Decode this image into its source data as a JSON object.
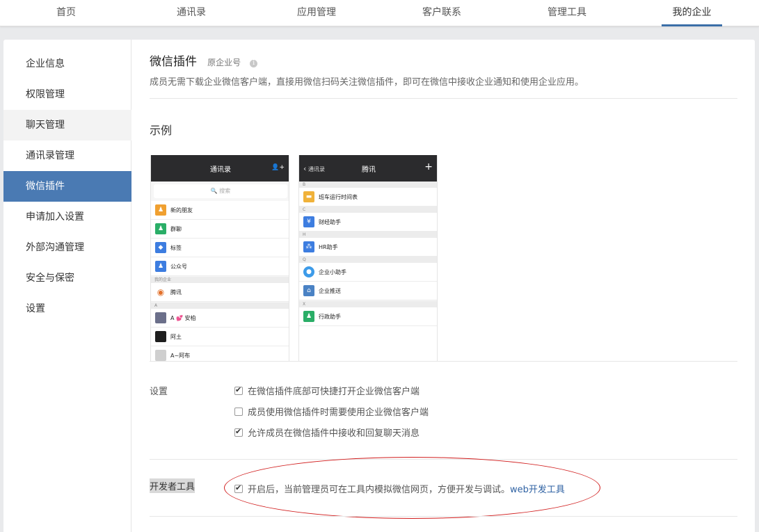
{
  "topnav": {
    "tabs": [
      {
        "label": "首页"
      },
      {
        "label": "通讯录"
      },
      {
        "label": "应用管理"
      },
      {
        "label": "客户联系"
      },
      {
        "label": "管理工具"
      },
      {
        "label": "我的企业"
      }
    ],
    "active_tab": "我的企业"
  },
  "sidebar": {
    "items": [
      {
        "label": "企业信息"
      },
      {
        "label": "权限管理"
      },
      {
        "label": "聊天管理"
      },
      {
        "label": "通讯录管理"
      },
      {
        "label": "微信插件"
      },
      {
        "label": "申请加入设置"
      },
      {
        "label": "外部沟通管理"
      },
      {
        "label": "安全与保密"
      },
      {
        "label": "设置"
      }
    ],
    "active_item": "微信插件",
    "hovered_item": "聊天管理"
  },
  "main": {
    "title": "微信插件",
    "subtitle": "原企业号",
    "info_icon": "i",
    "description": "成员无需下载企业微信客户端，直接用微信扫码关注微信插件，即可在微信中接收企业通知和使用企业应用。",
    "example_label": "示例",
    "phone1": {
      "title": "通讯录",
      "add_icon": "👤+",
      "search_placeholder": "🔍 搜索",
      "rows": [
        {
          "label": "新的朋友",
          "icon": "person-add-icon",
          "color": "#f0a030"
        },
        {
          "label": "群聊",
          "icon": "group-icon",
          "color": "#2aae67"
        },
        {
          "label": "标签",
          "icon": "tag-icon",
          "color": "#3d7de0"
        },
        {
          "label": "公众号",
          "icon": "official-account-icon",
          "color": "#3d7de0"
        }
      ],
      "section_company": "我的企业",
      "company_row": {
        "label": "腾讯",
        "icon": "tencent-logo"
      },
      "section_a": "A",
      "contacts": [
        {
          "label": "A 💕 安柏"
        },
        {
          "label": "阿土"
        },
        {
          "label": "A~阿布"
        }
      ]
    },
    "phone2": {
      "back_label": "通讯录",
      "title": "腾讯",
      "plus": "+",
      "sections": [
        "B",
        "C",
        "H",
        "Q",
        "X"
      ],
      "rows": [
        {
          "label": "班车运行时间表",
          "icon": "bus-schedule-icon",
          "color": "#f0b23a"
        },
        {
          "label": "财经助手",
          "icon": "yen-icon",
          "color": "#3d7de0"
        },
        {
          "label": "HR助手",
          "icon": "hr-icon",
          "color": "#3d7de0"
        },
        {
          "label": "企业小助手",
          "icon": "chat-bubble-icon",
          "color": "#3d9be9"
        },
        {
          "label": "企业推送",
          "icon": "home-icon",
          "color": "#4a82c4"
        },
        {
          "label": "行政助手",
          "icon": "person-icon",
          "color": "#2aae67"
        }
      ]
    },
    "settings": {
      "label": "设置",
      "options": [
        {
          "label": "在微信插件底部可快捷打开企业微信客户端",
          "checked": true
        },
        {
          "label": "成员使用微信插件时需要使用企业微信客户端",
          "checked": false
        },
        {
          "label": "允许成员在微信插件中接收和回复聊天消息",
          "checked": true
        }
      ]
    },
    "developer": {
      "label": "开发者工具",
      "checked": true,
      "text": "开启后，当前管理员可在工具内模拟微信网页，方便开发与调试。",
      "link": "web开发工具"
    }
  },
  "colors": {
    "accent": "#4a7ab3",
    "annotation": "#d11d1d",
    "link": "#2f62a3"
  }
}
